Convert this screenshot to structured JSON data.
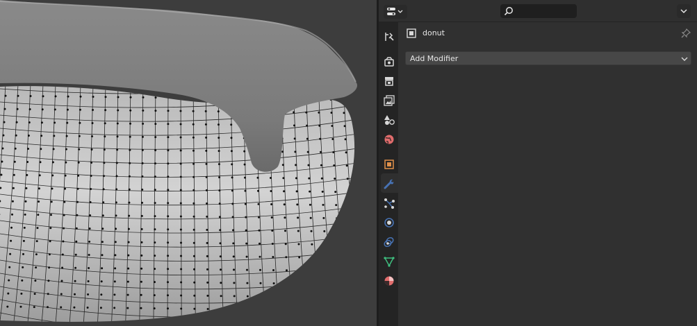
{
  "viewport": {
    "label": "3D viewport - donut mesh in edit mode"
  },
  "properties": {
    "header": {
      "editor_type_icon": "properties-editor-icon",
      "search_icon": "search-icon",
      "search_value": "",
      "options_icon": "chevron-down-icon"
    },
    "tabs": [
      {
        "icon": "tool-icon",
        "active": false
      },
      {
        "icon": "render-icon",
        "active": false
      },
      {
        "icon": "output-icon",
        "active": false
      },
      {
        "icon": "view-layer-icon",
        "active": false
      },
      {
        "icon": "scene-icon",
        "active": false
      },
      {
        "icon": "world-icon",
        "active": false
      },
      {
        "icon": "object-icon",
        "active": false
      },
      {
        "icon": "modifier-icon",
        "active": true
      },
      {
        "icon": "particles-icon",
        "active": false
      },
      {
        "icon": "physics-icon",
        "active": false
      },
      {
        "icon": "constraints-icon",
        "active": false
      },
      {
        "icon": "data-icon",
        "active": false
      },
      {
        "icon": "material-icon",
        "active": false
      }
    ],
    "object_name": "donut",
    "add_modifier_label": "Add Modifier",
    "colors": {
      "accent_blue": "#4772b3",
      "object_orange": "#e0904a",
      "world_red": "#e06c6c",
      "data_green": "#3fbf7f"
    }
  }
}
